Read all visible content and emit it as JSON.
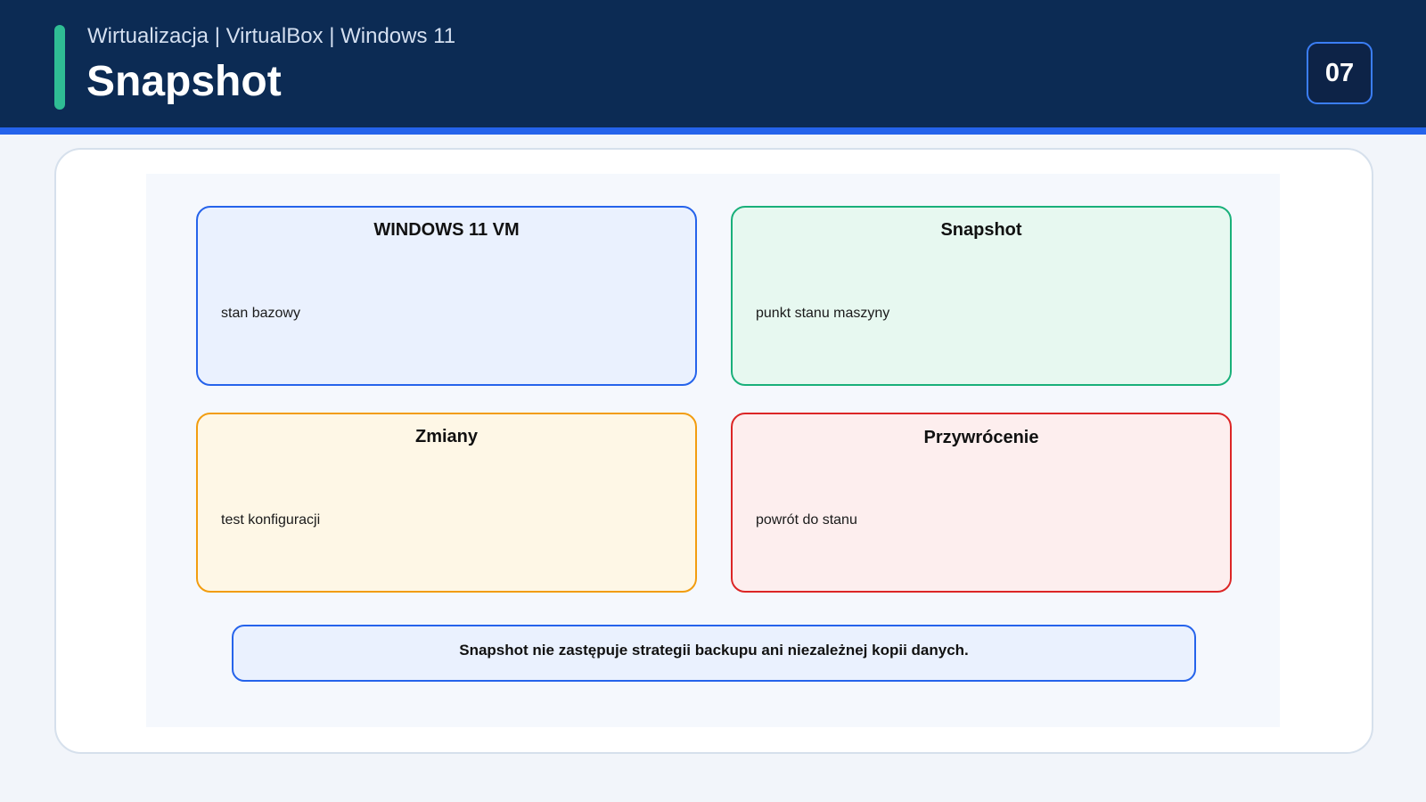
{
  "header": {
    "subtitle": "Wirtualizacja | VirtualBox | Windows 11",
    "title": "Snapshot",
    "page_number": "07"
  },
  "diagram": {
    "boxes": [
      {
        "title": "WINDOWS 11 VM",
        "description": "stan bazowy",
        "color": "#2563eb"
      },
      {
        "title": "Snapshot",
        "description": "punkt stanu maszyny",
        "color": "#19b07a"
      },
      {
        "title": "Zmiany",
        "description": "test konfiguracji",
        "color": "#f29d0f"
      },
      {
        "title": "Przywrócenie",
        "description": "powrót do stanu",
        "color": "#dc2626"
      }
    ],
    "note": "Snapshot nie zastępuje strategii backupu ani niezależnej kopii danych."
  },
  "colors": {
    "header_bg": "#0c2b54",
    "accent": "#2fbd94",
    "stripe": "#2563eb"
  }
}
